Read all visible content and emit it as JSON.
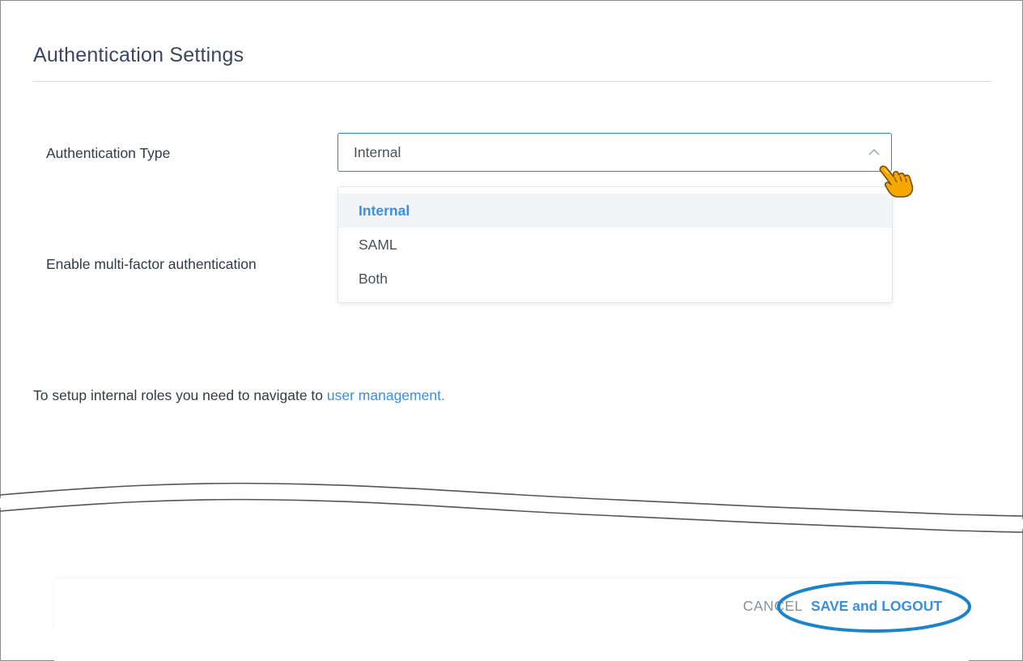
{
  "page": {
    "title": "Authentication Settings"
  },
  "form": {
    "auth_type_label": "Authentication Type",
    "auth_type_value": "Internal",
    "mfa_label": "Enable multi-factor authentication"
  },
  "dropdown": {
    "options": [
      "Internal",
      "SAML",
      "Both"
    ],
    "selected": "Internal"
  },
  "note": {
    "text": "To setup internal roles you need to navigate to",
    "link_text": "user management."
  },
  "footer": {
    "cancel_label": "CANCEL",
    "save_label": "SAVE and LOGOUT"
  },
  "colors": {
    "accent": "#3a8fe0",
    "select_border": "#2b8fa3",
    "highlight_ring": "#1a83c9",
    "cursor_hand": "#f5a800"
  },
  "icons": {
    "select_chevron": "chevron-up-icon",
    "cursor": "pointing-hand-cursor-icon"
  }
}
